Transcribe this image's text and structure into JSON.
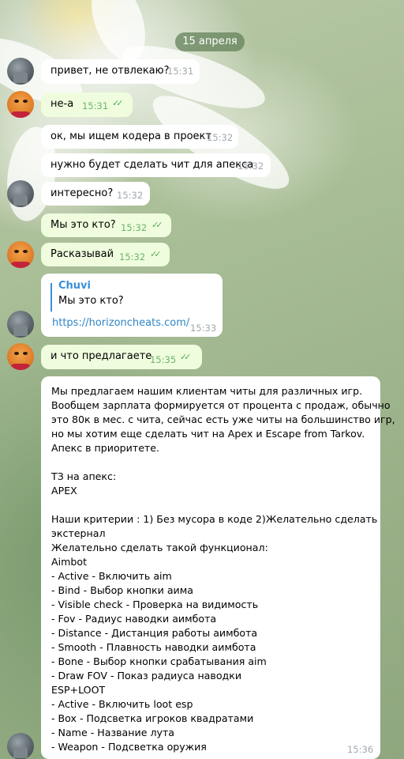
{
  "date_label": "15 апреля",
  "messages": [
    {
      "text": "привет, не отвлекаю?",
      "time": "15:31"
    },
    {
      "text": "не-а",
      "time": "15:31"
    },
    {
      "text": "ок, мы ищем кодера в проект",
      "time": "15:32"
    },
    {
      "text": "нужно будет сделать чит для апекса",
      "time": "15:32"
    },
    {
      "text": "интересно?",
      "time": "15:32"
    },
    {
      "text": "Мы это кто?",
      "time": "15:32"
    },
    {
      "text": "Расказывай",
      "time": "15:32"
    },
    {
      "quote_name": "Chuvi",
      "quote_text": "Мы это кто?",
      "link": "https://horizoncheats.com/",
      "time": "15:33"
    },
    {
      "text": "и что предлагаете",
      "time": "15:35"
    },
    {
      "lines": [
        "Мы предлагаем нашим клиентам читы для различных игр.",
        "Вообщем зарплата формируется от процента с продаж, обычно",
        "это 80к в мес. с чита, сейчас есть уже читы на большинство игр,",
        "но мы хотим еще сделать чит на Apex и Escape from Tarkov.",
        "Апекс в приоритете.",
        "",
        "ТЗ на апекс:",
        "APEX",
        "",
        " Наши критерии : 1) Без мусора в коде 2)Желательно сделать",
        "экстернал",
        "Желательно сделать такой функционал:",
        "Aimbot",
        "- Active - Включить aim",
        "- Bind - Выбор кнопки аима",
        "- Visible check - Проверка на видимость",
        "- Fov - Радиус наводки аимбота",
        "- Distance - Дистанция работы аимбота",
        "- Smooth - Плавность наводки аимбота",
        "- Bone - Выбор кнопки срабатывания aim",
        "- Draw FOV - Показ радиуса наводки",
        "ESP+LOOT",
        "- Active - Включить loot esp",
        "- Box - Подсветка игроков квадратами",
        "- Name - Название лута",
        "- Weapon - Подсветка оружия"
      ],
      "time": "15:36"
    }
  ]
}
